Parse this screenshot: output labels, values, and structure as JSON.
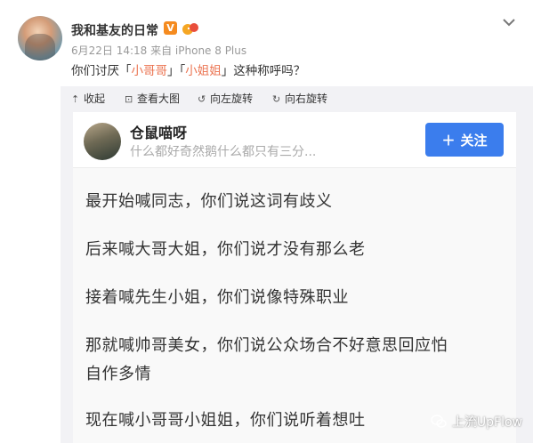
{
  "post": {
    "user_name": "我和基友的日常",
    "verified_label": "V",
    "meta": "6月22日 14:18 来自 iPhone 8 Plus",
    "text_parts": [
      "你们讨厌「",
      "小哥哥",
      "」「",
      "小姐姐",
      "」这种称呼吗？"
    ]
  },
  "toolbar": {
    "items": [
      {
        "icon": "collapse-icon",
        "label": "收起"
      },
      {
        "icon": "zoom-icon",
        "label": "查看大图"
      },
      {
        "icon": "rotate-left-icon",
        "label": "向左旋转"
      },
      {
        "icon": "rotate-right-icon",
        "label": "向右旋转"
      }
    ]
  },
  "card": {
    "name": "仓鼠喵呀",
    "bio": "什么都好奇然鹅什么都只有三分...",
    "follow_label": "关注",
    "lines": [
      "最开始喊同志，你们说这词有歧义",
      "后来喊大哥大姐，你们说才没有那么老",
      "接着喊先生小姐，你们说像特殊职业",
      "那就喊帅哥美女，你们说公众场合不好意思回应怕",
      "自作多情",
      "现在喊小哥哥小姐姐，你们说听着想吐"
    ]
  },
  "watermark": "上流UpFlow",
  "colors": {
    "highlight": "#eb7350",
    "follow_button": "#3b7ded",
    "verified_badge": "#f58b1f"
  }
}
